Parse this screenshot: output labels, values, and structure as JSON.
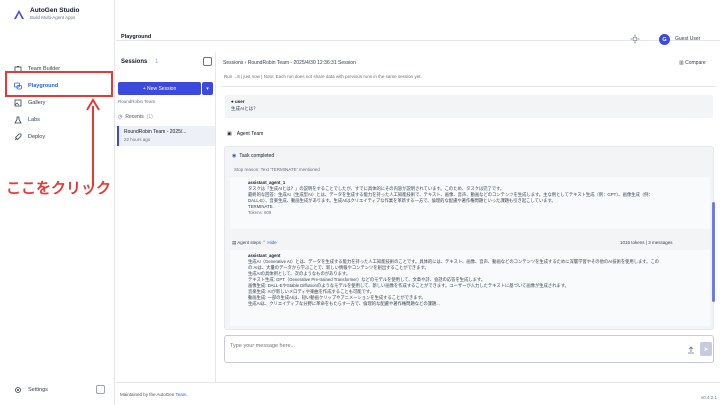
{
  "brand": {
    "title": "AutoGen Studio",
    "subtitle": "Build Multi-Agent Apps"
  },
  "sidebar": {
    "items": [
      {
        "label": "Team Builder"
      },
      {
        "label": "Playground"
      },
      {
        "label": "Gallery"
      },
      {
        "label": "Labs"
      },
      {
        "label": "Deploy"
      }
    ],
    "settings": "Settings"
  },
  "annotation": {
    "text": "ここをクリック"
  },
  "topbar": {
    "title": "Playground",
    "user_initial": "G",
    "user_name": "Guest User"
  },
  "sessions": {
    "title": "Sessions",
    "count": "1",
    "new_session": "+ New Session",
    "team": "RoundRobin Team",
    "recents_label": "Recents",
    "recents_count": "(1)",
    "card_name": "RoundRobin Team - 2025/...",
    "card_time": "22 hours ago"
  },
  "main": {
    "crumbs": "Sessions  ›  RoundRobin Team - 2025/4/30 12:36:31 Session",
    "compare": "Compare",
    "run_info": "Run ...8 | just now |  Note: Each run does not share data with previous runs in the same session yet.",
    "user_who": "user",
    "user_text": "生成AIとは？",
    "agent_team": "Agent Team",
    "task_done": "Task completed",
    "stop_reason": "Stop reason: Text 'TERMINATE' mentioned",
    "final_lines": [
      "assistant_agent_1",
      "タスクは「生成AIとは？」の説明をすることでしたが、すでに具体的にその内容が説明されています。このため、タスクは完了です。",
      "最終的な回答：生成AI（生成型AI）とは、データを生成する能力を持った人工知能技術で、テキスト、画像、音声、動画などのコンテンツを生成します。主な例としてテキスト生成（例：GPT）、画像生成（例：",
      "DALL-E）、音楽生成、動画生成があります。生成AIはクリエイティブな作業を革新する一方で、倫理的な配慮や著作権問題といった課題も引き起こしています。",
      "TERMINATE.",
      "Tokens: 609"
    ],
    "agent_steps": "Agent steps",
    "hide": "Hide",
    "tokens_info": "1016 tokens | 3 messages",
    "step_lines": [
      "assistant_agent",
      "生成AI（Generative AI）とは、データを生成する能力を持った人工知能技術のことです。具体的には、テキスト、画像、音声、動画などのコンテンツを生成するために深層学習やその他のAI技術を使用します。この",
      "の AIは、大量のデータから学ぶことで、新しい情報やコンテンツを創出することができます。",
      "生成AIの具体例として、次のようなものがあります。",
      "テキスト生成: GPT（Generative Pre-trained Transformer）などのモデルを使用して、文章や詩、会話の応答を生成します。",
      "画像生成: DALL-EやStable Diffusionのようなモデルを使用して、新しい画像を作成することができます。ユーザーが入力したテキストに基づいて画像が生成されます。",
      "音楽生成: AIが新しいメロディや楽曲を作成することも可能です。",
      "動画生成: 一部の生成AIは、短い動画クリップやアニメーションを生成することができます。",
      "生成AIは、クリエイティブな分野に革命をもたらす一方で、倫理的な配慮や著作権問題などの課題..."
    ],
    "input_placeholder": "Type your message here..."
  },
  "footer": {
    "text": "Maintained by the AutoGen ",
    "link": "Team.",
    "version": "v0.4.2.1"
  },
  "colors": {
    "accent": "#3b49df",
    "annotation": "#e53935"
  },
  "icons": [
    "logo-icon",
    "team-builder-icon",
    "playground-icon",
    "gallery-icon",
    "labs-icon",
    "deploy-icon",
    "settings-icon",
    "theme-icon",
    "upload-icon",
    "send-icon"
  ]
}
